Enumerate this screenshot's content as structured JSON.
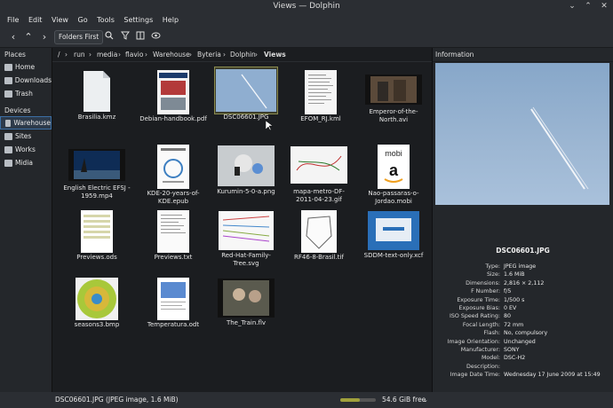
{
  "window": {
    "title": "Views — Dolphin",
    "controls": [
      "⌄",
      "⌃",
      "✕"
    ]
  },
  "menu": [
    "File",
    "Edit",
    "View",
    "Go",
    "Tools",
    "Settings",
    "Help"
  ],
  "toolbar": {
    "folders_first": "Folders First"
  },
  "places": {
    "header": "Places",
    "items": [
      {
        "label": "Home"
      },
      {
        "label": "Downloads"
      },
      {
        "label": "Trash"
      }
    ]
  },
  "devices": {
    "header": "Devices",
    "items": [
      {
        "label": "Warehouse"
      },
      {
        "label": "Sites"
      },
      {
        "label": "Works"
      },
      {
        "label": "Midia"
      }
    ]
  },
  "breadcrumb": [
    "/",
    "run",
    "media",
    "flavio",
    "Warehouse",
    "Byteria",
    "Dolphin",
    "Views"
  ],
  "files": [
    {
      "name": "Brasilia.kmz"
    },
    {
      "name": "Debian-handbook.pdf"
    },
    {
      "name": "DSC06601.JPG"
    },
    {
      "name": "EFOM_RJ.kml"
    },
    {
      "name": "Emperor-of-the-North.avi"
    },
    {
      "name": "English Electric EFSJ - 1959.mp4"
    },
    {
      "name": "KDE-20-years-of-KDE.epub"
    },
    {
      "name": "Kurumin-5-0-a.png"
    },
    {
      "name": "mapa-metro-DF-2011-04-23.gif"
    },
    {
      "name": "Nao-passaras-o-Jordao.mobi"
    },
    {
      "name": "Previews.ods"
    },
    {
      "name": "Previews.txt"
    },
    {
      "name": "Red-Hat-Family-Tree.svg"
    },
    {
      "name": "RF46-8-Brasil.tif"
    },
    {
      "name": "SDDM-text-only.xcf"
    },
    {
      "name": "seasons3.bmp"
    },
    {
      "name": "Temperatura.odt"
    },
    {
      "name": "The_Train.flv"
    }
  ],
  "selected_file": "DSC06601.JPG",
  "info": {
    "header": "Information",
    "name": "DSC06601.JPG",
    "rows": [
      {
        "k": "Type:",
        "v": "JPEG image"
      },
      {
        "k": "Size:",
        "v": "1.6 MiB"
      },
      {
        "k": "Dimensions:",
        "v": "2,816 × 2,112"
      },
      {
        "k": "F Number:",
        "v": "f/5"
      },
      {
        "k": "Exposure Time:",
        "v": "1/500 s"
      },
      {
        "k": "Exposure Bias:",
        "v": "0 EV"
      },
      {
        "k": "ISO Speed Rating:",
        "v": "80"
      },
      {
        "k": "Focal Length:",
        "v": "72 mm"
      },
      {
        "k": "Flash:",
        "v": "No, compulsory"
      },
      {
        "k": "Image Orientation:",
        "v": "Unchanged"
      },
      {
        "k": "Manufacturer:",
        "v": "SONY"
      },
      {
        "k": "Model:",
        "v": "DSC-H2"
      },
      {
        "k": "Description:",
        "v": ""
      },
      {
        "k": "Image Date Time:",
        "v": "Wednesday 17 June 2009 at 15:49"
      }
    ]
  },
  "status": {
    "text": "DSC06601.JPG (JPEG image, 1.6 MiB)",
    "free": "54.6 GiB free",
    "used_fraction": 0.55,
    "chevron": "⌄"
  }
}
